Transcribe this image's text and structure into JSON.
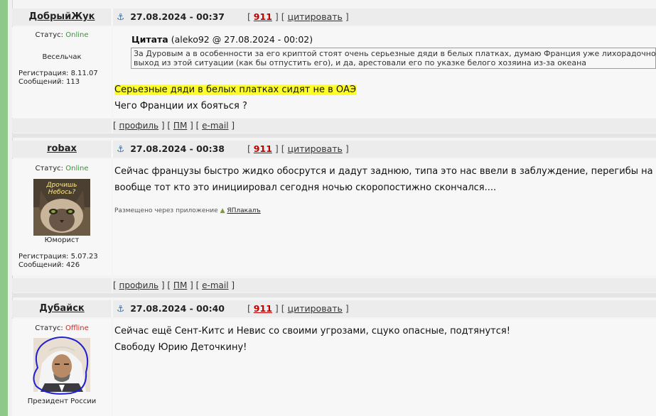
{
  "posts": [
    {
      "author": "ДобрыйЖук",
      "anchor_icon": "anchor-icon",
      "date": "27.08.2024 - 00:37",
      "post_number": "911",
      "quote_label": "цитировать",
      "status_label": "Статус:",
      "status": "Online",
      "rank": "Весельчак",
      "registration": "Регистрация: 8.11.07",
      "messages": "Сообщений: 113",
      "quote": {
        "label": "Цитата",
        "meta": "(aleko92 @ 27.08.2024 - 00:02)",
        "line1": "За Дуровым а в особенности за его криптой стоят очень серьезные дяди в белых платках, думаю Франция уже лихорадочно ищ",
        "line2": "выход из этой ситуации (как бы отпустить его), и да, арестовали его по указке белого хозяина из-за океана"
      },
      "highlighted_text": "Серьезные дяди в белых платках сидят не в ОАЭ",
      "text": "Чего Франции их бояться ?",
      "footer": {
        "profile": "профиль",
        "pm": "ПМ",
        "email": "e-mail"
      }
    },
    {
      "author": "robax",
      "date": "27.08.2024 - 00:38",
      "post_number": "911",
      "quote_label": "цитировать",
      "status_label": "Статус:",
      "status": "Online",
      "avatar_text": "Дрочишь\nНебось?",
      "rank": "Юморист",
      "registration": "Регистрация: 5.07.23",
      "messages": "Сообщений: 426",
      "line1": "Сейчас французы быстро жидко обосрутся и дадут заднюю, типа это нас ввели в заблуждение, перегибы на ме",
      "line2": "вообще тот кто это инициировал сегодня ночью скоропостижно скончался....",
      "via_label": "Размещено через приложение",
      "via_app": "ЯПлакалъ",
      "footer": {
        "profile": "профиль",
        "pm": "ПМ",
        "email": "e-mail"
      }
    },
    {
      "author": "Дубайск",
      "date": "27.08.2024 - 00:40",
      "post_number": "911",
      "quote_label": "цитировать",
      "status_label": "Статус:",
      "status": "Offline",
      "rank": "Президент России",
      "line1": "Сейчас ещё Сент-Китс и Невис со своими угрозами, сцуко опасные, подтянутся!",
      "line2": "Свободу Юрию Деточкину!"
    }
  ]
}
